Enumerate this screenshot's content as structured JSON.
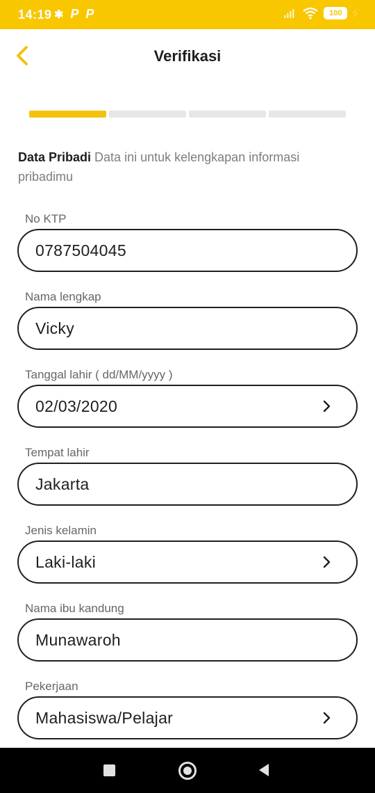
{
  "status_bar": {
    "time": "14:19",
    "left_icons": [
      "bluetooth-icon",
      "parking-app-icon",
      "parking-app-icon"
    ],
    "right_icons": [
      "signal-icon",
      "wifi-icon",
      "battery-icon",
      "charging-icon"
    ],
    "battery_level": "100",
    "background_color": "#f8c700"
  },
  "header": {
    "title": "Verifikasi",
    "back_icon": "chevron-left-icon",
    "accent_color": "#f4c20d"
  },
  "progress": {
    "total_steps": 4,
    "current_step": 1
  },
  "intro": {
    "title": "Data Pribadi",
    "description": "Data ini untuk kelengkapan informasi pribadimu"
  },
  "form": {
    "ktp": {
      "label": "No KTP",
      "value": "0787504045"
    },
    "full_name": {
      "label": "Nama lengkap",
      "value": "Vicky"
    },
    "birth_date": {
      "label": "Tanggal lahir ( dd/MM/yyyy )",
      "value": "02/03/2020",
      "icon": "chevron-right-icon"
    },
    "birth_place": {
      "label": "Tempat lahir",
      "value": "Jakarta"
    },
    "gender": {
      "label": "Jenis kelamin",
      "value": "Laki-laki",
      "icon": "chevron-right-icon"
    },
    "mother_name": {
      "label": "Nama ibu kandung",
      "value": "Munawaroh"
    },
    "occupation": {
      "label": "Pekerjaan",
      "value": "Mahasiswa/Pelajar",
      "icon": "chevron-right-icon"
    }
  },
  "nav_bar": {
    "icons": [
      "recent-apps-icon",
      "home-icon",
      "back-icon"
    ]
  }
}
